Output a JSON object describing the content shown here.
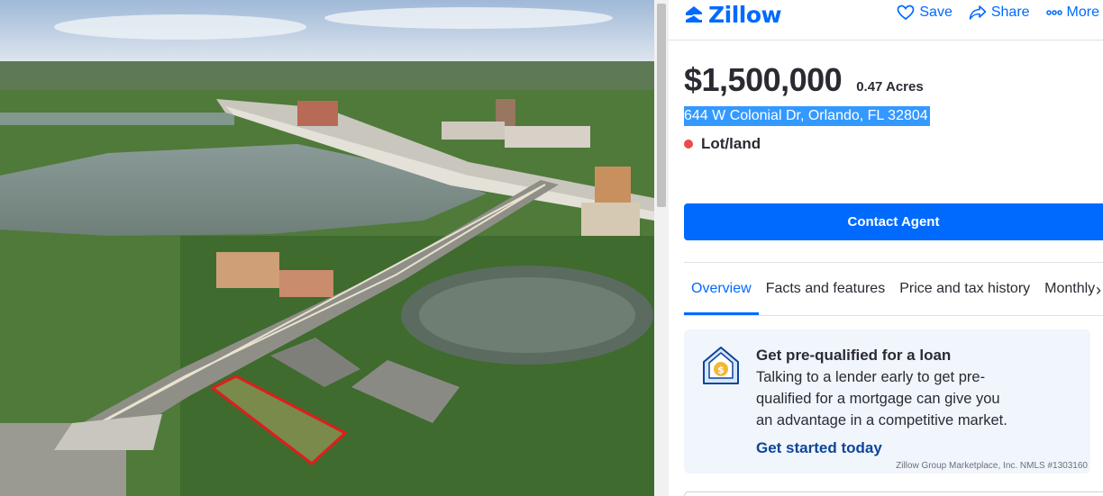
{
  "header": {
    "brand": "Zillow",
    "actions": [
      {
        "label": "Save",
        "icon": "heart-icon"
      },
      {
        "label": "Share",
        "icon": "share-icon"
      },
      {
        "label": "More",
        "icon": "more-icon"
      }
    ]
  },
  "listing": {
    "price": "$1,500,000",
    "lot_size": "0.47 Acres",
    "address": "644 W Colonial Dr, Orlando, FL 32804",
    "status": "Lot/land",
    "status_color": "#ea4c4c"
  },
  "contact_button": "Contact Agent",
  "tabs": [
    {
      "label": "Overview",
      "active": true
    },
    {
      "label": "Facts and features",
      "active": false
    },
    {
      "label": "Price and tax history",
      "active": false
    },
    {
      "label": "Monthly",
      "active": false
    }
  ],
  "loan_card": {
    "title": "Get pre-qualified for a loan",
    "body": "Talking to a lender early to get pre-qualified for a mortgage can give you an advantage in a competitive market.",
    "link": "Get started today",
    "disclaimer": "Zillow Group Marketplace, Inc. NMLS #1303160"
  },
  "colors": {
    "brand_blue": "#006aff",
    "link_dark": "#0d4599",
    "card_bg": "#f1f6fd"
  }
}
